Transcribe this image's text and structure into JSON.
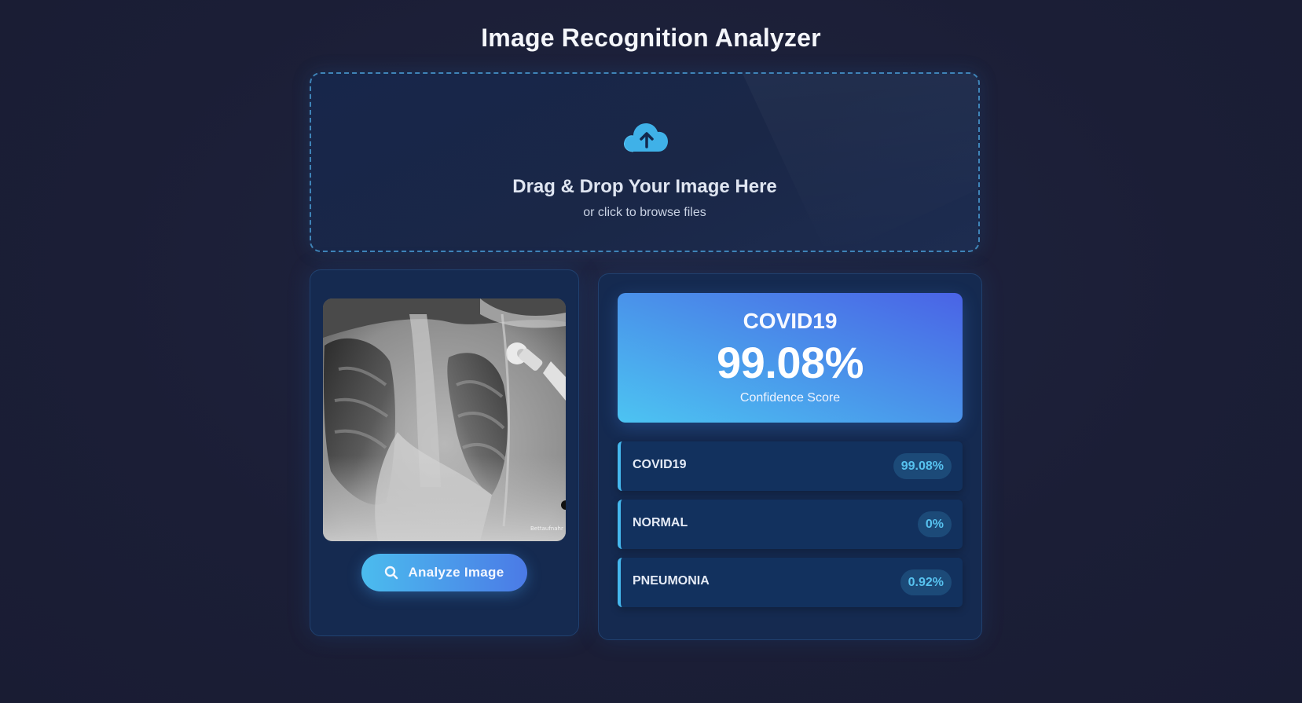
{
  "header": {
    "title": "Image Recognition Analyzer"
  },
  "upload": {
    "icon": "cloud-upload-icon",
    "title": "Drag & Drop Your Image Here",
    "subtitle": "or click to browse files"
  },
  "preview": {
    "image_icon": "chest-xray-image",
    "watermark": "Bettaufnahr",
    "analyze_button": {
      "icon": "search-icon",
      "label": "Analyze Image"
    }
  },
  "result": {
    "top_label": "COVID19",
    "top_score": "99.08%",
    "caption": "Confidence Score",
    "predictions": [
      {
        "label": "COVID19",
        "value": "99.08%"
      },
      {
        "label": "NORMAL",
        "value": "0%"
      },
      {
        "label": "PNEUMONIA",
        "value": "0.92%"
      }
    ]
  },
  "colors": {
    "background": "#1b1e36",
    "panel": "#152a50",
    "accent_cyan": "#4cc4f2",
    "accent_blue": "#4a63e6",
    "badge_text": "#57c2ef"
  }
}
